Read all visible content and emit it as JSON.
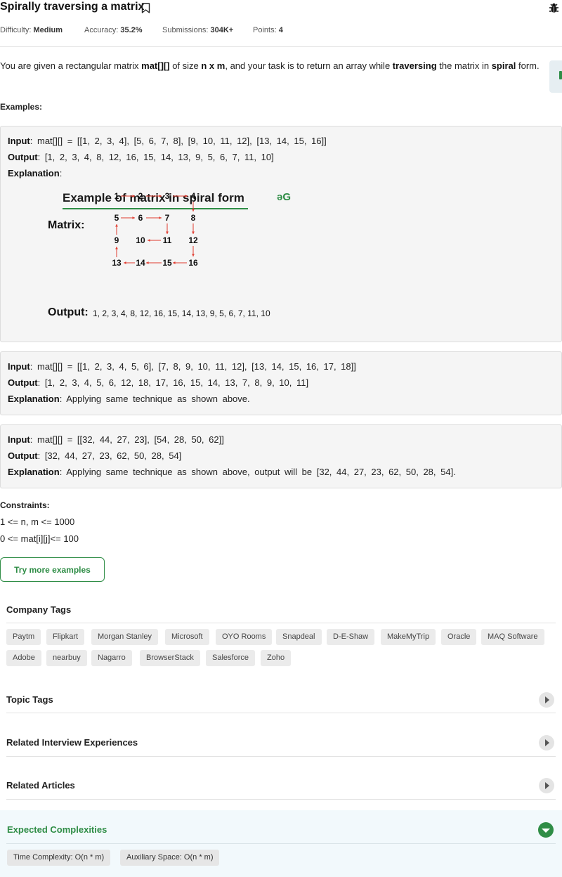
{
  "problem": {
    "title": "Spirally traversing a matrix",
    "meta": {
      "difficulty_label": "Difficulty:",
      "difficulty": "Medium",
      "accuracy_label": "Accuracy:",
      "accuracy": "35.2%",
      "submissions_label": "Submissions:",
      "submissions": "304K+",
      "points_label": "Points:",
      "points": "4"
    },
    "description": {
      "p1": "You are given a rectangular matrix ",
      "b1": "mat[][]",
      "p2": " of size ",
      "b2": "n x m",
      "p3": ", and your task is to return an array while ",
      "b3": "traversing",
      "p4": " the matrix in ",
      "b4": "spiral",
      "p5": " form."
    },
    "examples_heading": "Examples:",
    "examples": [
      {
        "input_label": "Input",
        "input": ": mat[][] = [[1, 2, 3, 4], [5, 6, 7, 8], [9, 10, 11, 12], [13, 14, 15, 16]]",
        "output_label": "Output",
        "output": ": [1, 2, 3, 4, 8, 12, 16, 15, 14, 13, 9, 5, 6, 7, 11, 10]",
        "explanation_label": "Explanation",
        "explanation": ":"
      },
      {
        "input_label": "Input",
        "input": ": mat[][] = [[1, 2, 3, 4, 5, 6], [7, 8, 9, 10, 11, 12], [13, 14, 15, 16, 17, 18]]",
        "output_label": "Output",
        "output": ": [1, 2, 3, 4, 5, 6, 12, 18, 17, 16, 15, 14, 13, 7, 8, 9, 10, 11]",
        "explanation_label": "Explanation",
        "explanation": ": Applying same technique as shown above."
      },
      {
        "input_label": "Input",
        "input": ": mat[][] = [[32, 44, 27, 23], [54, 28, 50, 62]]",
        "output_label": "Output",
        "output": ": [32, 44, 27, 23, 62, 50, 28, 54]",
        "explanation_label": "Explanation",
        "explanation": ": Applying same technique as shown above, output will be [32, 44, 27, 23, 62, 50, 28, 54]."
      }
    ],
    "figure": {
      "title": "Example of matrix in spiral form",
      "logo": "əG",
      "matrix_label": "Matrix:",
      "grid": [
        [
          "1",
          "2",
          "3",
          "4"
        ],
        [
          "5",
          "6",
          "7",
          "8"
        ],
        [
          "9",
          "10",
          "11",
          "12"
        ],
        [
          "13",
          "14",
          "15",
          "16"
        ]
      ],
      "output_label": "Output:",
      "output_value": "1, 2, 3, 4, 8, 12, 16, 15, 14, 13, 9, 5, 6, 7, 11, 10",
      "arrow_color": "#e03b2f"
    },
    "constraints_heading": "Constraints:",
    "constraints": [
      "1 <= n, m <= 1000",
      "0 <= mat[i][j]<= 100"
    ],
    "try_more_label": "Try more examples"
  },
  "company_tags": {
    "heading": "Company Tags",
    "row1": [
      "Paytm",
      "Flipkart",
      "Morgan Stanley",
      "Microsoft",
      "OYO Rooms",
      "Snapdeal",
      "D-E-Shaw",
      "MakeMyTrip",
      "Oracle",
      "MAQ Software"
    ],
    "row2": [
      "Adobe",
      "nearbuy",
      "Nagarro",
      "BrowserStack",
      "Salesforce",
      "Zoho"
    ]
  },
  "sections": [
    {
      "title": "Topic Tags",
      "icon": "chevron-right-icon"
    },
    {
      "title": "Related Interview Experiences",
      "icon": "chevron-right-icon"
    },
    {
      "title": "Related Articles",
      "icon": "chevron-right-icon"
    }
  ],
  "expected": {
    "title": "Expected Complexities",
    "icon": "chevron-down-icon",
    "tags": [
      "Time Complexity: O(n * m)",
      "Auxiliary Space: O(n * m)"
    ]
  },
  "colors": {
    "accent": "#2f8d46",
    "arrow": "#e03b2f"
  }
}
